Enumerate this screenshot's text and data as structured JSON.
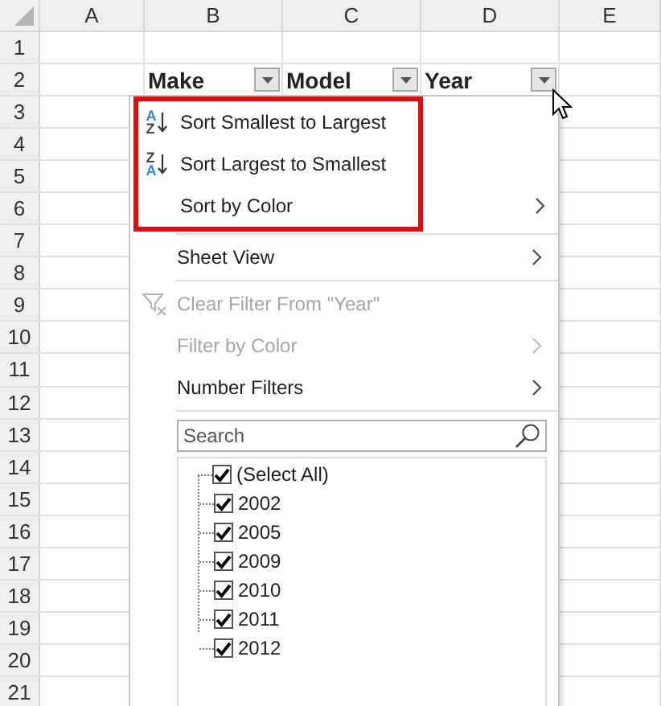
{
  "sheet": {
    "columns": [
      "A",
      "B",
      "C",
      "D",
      "E"
    ],
    "rows": [
      "1",
      "2",
      "3",
      "4",
      "5",
      "6",
      "7",
      "8",
      "9",
      "10",
      "11",
      "12",
      "13",
      "14",
      "15",
      "16",
      "17",
      "18",
      "19",
      "20",
      "21"
    ],
    "headers": [
      {
        "text": "Make"
      },
      {
        "text": "Model"
      },
      {
        "text": "Year"
      }
    ]
  },
  "filter_menu": {
    "sort_section": {
      "highlighted": true,
      "items": [
        {
          "kind": "sort",
          "letters": [
            "A",
            "Z"
          ],
          "label": "Sort Smallest to Largest",
          "submenu": false,
          "disabled": false
        },
        {
          "kind": "sort",
          "letters": [
            "Z",
            "A"
          ],
          "label": "Sort Largest to Smallest",
          "submenu": false,
          "disabled": false
        },
        {
          "kind": "plain",
          "label": "Sort by Color",
          "submenu": true,
          "disabled": false
        }
      ]
    },
    "items": [
      {
        "kind": "separator"
      },
      {
        "kind": "plain",
        "label": "Sheet View",
        "submenu": true,
        "disabled": false
      },
      {
        "kind": "separator"
      },
      {
        "kind": "clear-filter",
        "label": "Clear Filter From \"Year\"",
        "submenu": false,
        "disabled": true
      },
      {
        "kind": "plain",
        "label": "Filter by Color",
        "submenu": true,
        "disabled": true
      },
      {
        "kind": "plain",
        "label": "Number Filters",
        "submenu": true,
        "disabled": false
      },
      {
        "kind": "separator"
      }
    ],
    "search": {
      "placeholder": "Search"
    },
    "values": [
      {
        "label": "(Select All)",
        "checked": true,
        "children": [
          {
            "label": "2002",
            "checked": true
          },
          {
            "label": "2005",
            "checked": true
          },
          {
            "label": "2009",
            "checked": true
          },
          {
            "label": "2010",
            "checked": true
          },
          {
            "label": "2011",
            "checked": true
          },
          {
            "label": "2012",
            "checked": true
          }
        ]
      }
    ]
  }
}
